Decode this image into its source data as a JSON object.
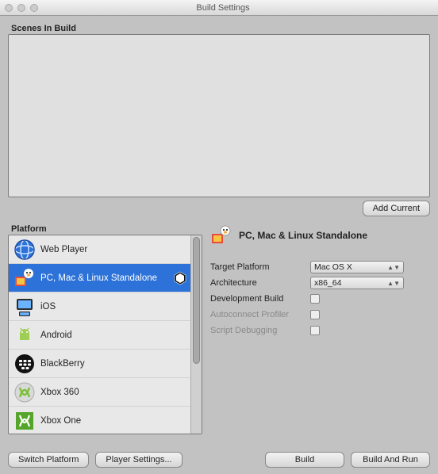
{
  "window": {
    "title": "Build Settings"
  },
  "scenes": {
    "label": "Scenes In Build",
    "add_button": "Add Current"
  },
  "platform": {
    "label": "Platform",
    "items": [
      {
        "name": "Web Player",
        "selected": false,
        "unity_badge": false
      },
      {
        "name": "PC, Mac & Linux Standalone",
        "selected": true,
        "unity_badge": true
      },
      {
        "name": "iOS",
        "selected": false,
        "unity_badge": false
      },
      {
        "name": "Android",
        "selected": false,
        "unity_badge": false
      },
      {
        "name": "BlackBerry",
        "selected": false,
        "unity_badge": false
      },
      {
        "name": "Xbox 360",
        "selected": false,
        "unity_badge": false
      },
      {
        "name": "Xbox One",
        "selected": false,
        "unity_badge": false
      }
    ]
  },
  "detail": {
    "title": "PC, Mac & Linux Standalone",
    "options": {
      "target_platform": {
        "label": "Target Platform",
        "value": "Mac OS X"
      },
      "architecture": {
        "label": "Architecture",
        "value": "x86_64"
      },
      "dev_build": {
        "label": "Development Build",
        "checked": false,
        "enabled": true
      },
      "autoconnect": {
        "label": "Autoconnect Profiler",
        "checked": false,
        "enabled": false
      },
      "script_debug": {
        "label": "Script Debugging",
        "checked": false,
        "enabled": false
      }
    }
  },
  "footer": {
    "switch_platform": "Switch Platform",
    "player_settings": "Player Settings...",
    "build": "Build",
    "build_and_run": "Build And Run"
  },
  "colors": {
    "selection": "#2d72d9"
  }
}
